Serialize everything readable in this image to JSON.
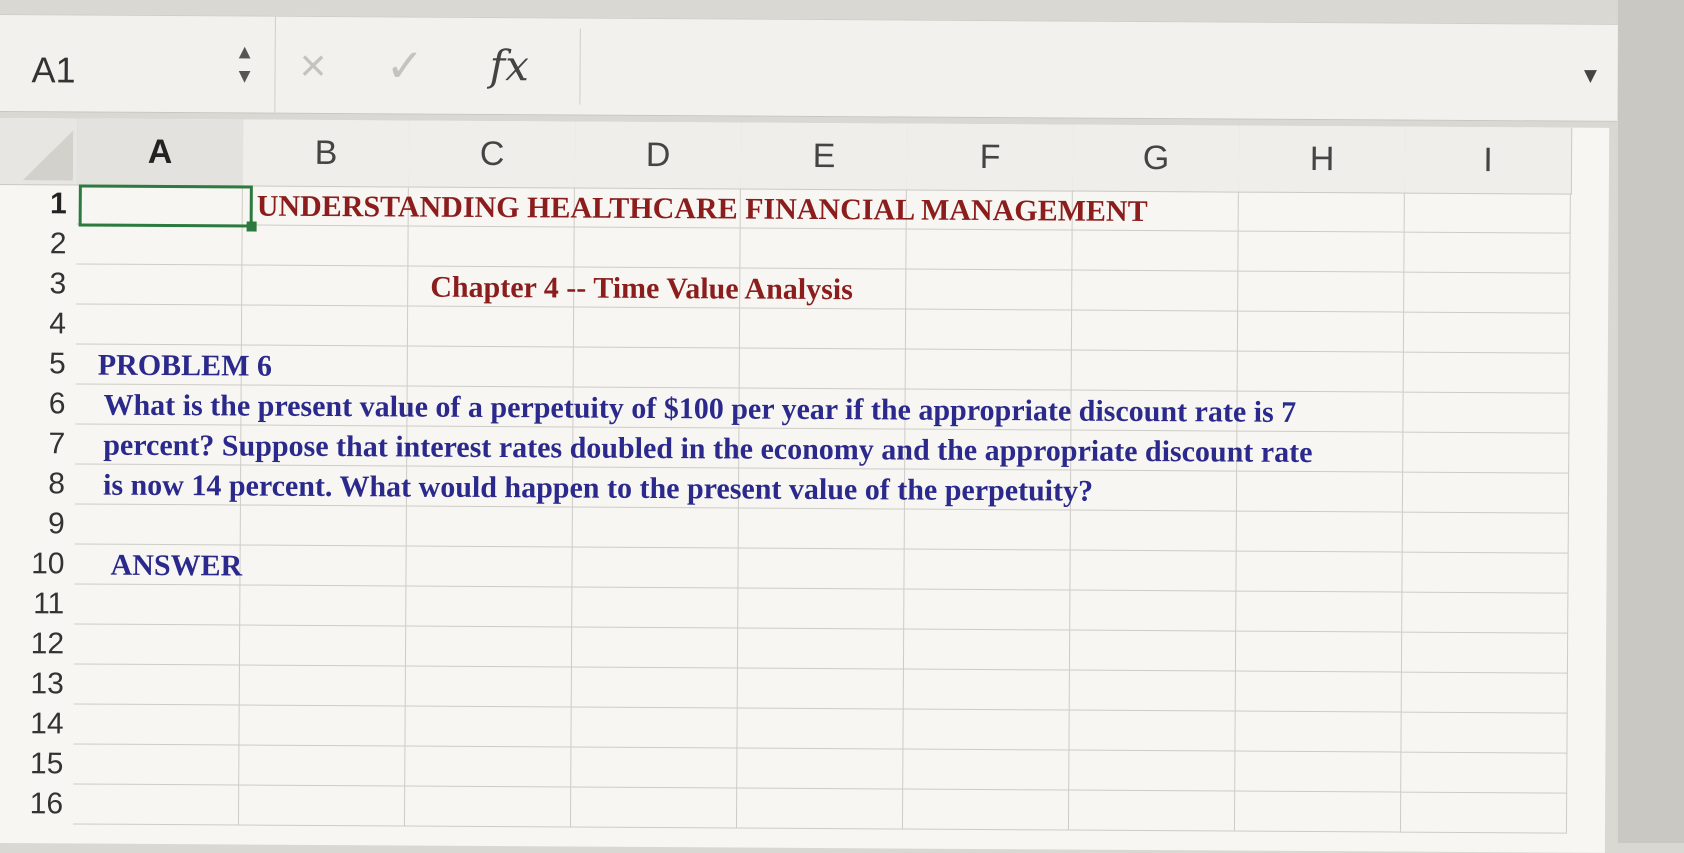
{
  "formula_bar": {
    "cell_ref": "A1",
    "cancel_icon": "×",
    "enter_icon": "✓",
    "fx_label": "fx",
    "formula_value": ""
  },
  "columns": [
    "A",
    "B",
    "C",
    "D",
    "E",
    "F",
    "G",
    "H",
    "I"
  ],
  "rows": [
    "1",
    "2",
    "3",
    "4",
    "5",
    "6",
    "7",
    "8",
    "9",
    "10",
    "11",
    "12",
    "13",
    "14",
    "15",
    "16"
  ],
  "cells": {
    "title": "UNDERSTANDING HEALTHCARE FINANCIAL MANAGEMENT",
    "subtitle": "Chapter 4 -- Time Value Analysis",
    "problem_label": "PROBLEM 6",
    "question_line1": "What is the present value of a perpetuity of $100 per year if the appropriate discount rate is 7",
    "question_line2": "percent? Suppose that interest rates doubled in the economy and the appropriate discount rate",
    "question_line3": "is now 14 percent. What would happen to the present value of the perpetuity?",
    "answer_label": "ANSWER"
  },
  "colors": {
    "selection": "#2c7a3f",
    "title_red": "#8b1d1d",
    "text_blue": "#2b2a8c"
  }
}
